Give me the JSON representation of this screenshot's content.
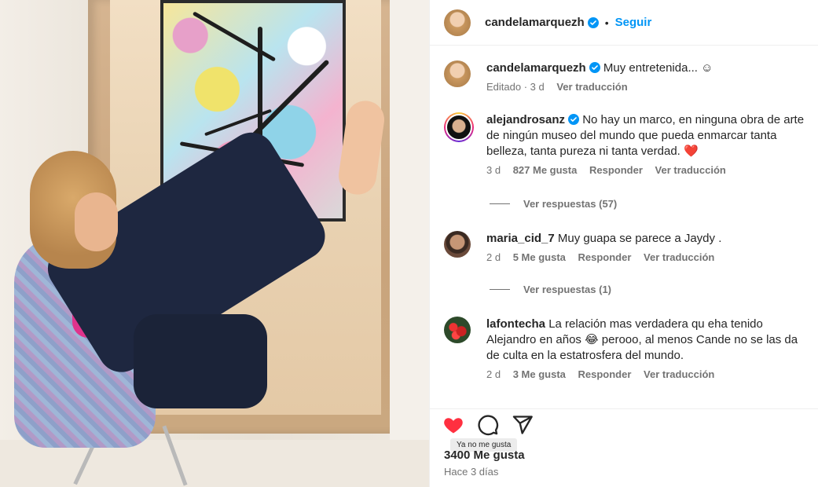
{
  "header": {
    "username": "candelamarquezh",
    "separator": "•",
    "follow_label": "Seguir"
  },
  "caption": {
    "username": "candelamarquezh",
    "text": "Muy entretenida... ☺",
    "edited": "Editado · 3 d",
    "translate": "Ver traducción"
  },
  "comments": [
    {
      "username": "alejandrosanz",
      "verified": true,
      "text": "No hay un marco, en ninguna obra de arte de ningún museo del mundo que pueda enmarcar tanta belleza, tanta pureza ni tanta verdad. ❤️",
      "time": "3 d",
      "likes": "827 Me gusta",
      "reply": "Responder",
      "translate": "Ver traducción",
      "replies": "Ver respuestas (57)"
    },
    {
      "username": "maria_cid_7",
      "verified": false,
      "text": "Muy guapa se parece a Jaydy .",
      "time": "2 d",
      "likes": "5 Me gusta",
      "reply": "Responder",
      "translate": "Ver traducción",
      "replies": "Ver respuestas (1)"
    },
    {
      "username": "lafontecha",
      "verified": false,
      "text": "La relación mas verdadera qu eha tenido Alejandro en años 😂 perooo, al menos Cande no se las da de culta en la estatrosfera del mundo.",
      "time": "2 d",
      "likes": "3 Me gusta",
      "reply": "Responder",
      "translate": "Ver traducción"
    }
  ],
  "actions": {
    "tooltip": "Ya no me gusta",
    "likes_count": "3400 Me gusta",
    "posted": "Hace 3 días"
  },
  "icons": [
    "heart-filled-icon",
    "comment-icon",
    "share-icon",
    "verified-badge-icon"
  ],
  "colors": {
    "accent": "#0095f6",
    "like": "#ff3040",
    "verified": "#0095f6",
    "muted": "#737373"
  }
}
